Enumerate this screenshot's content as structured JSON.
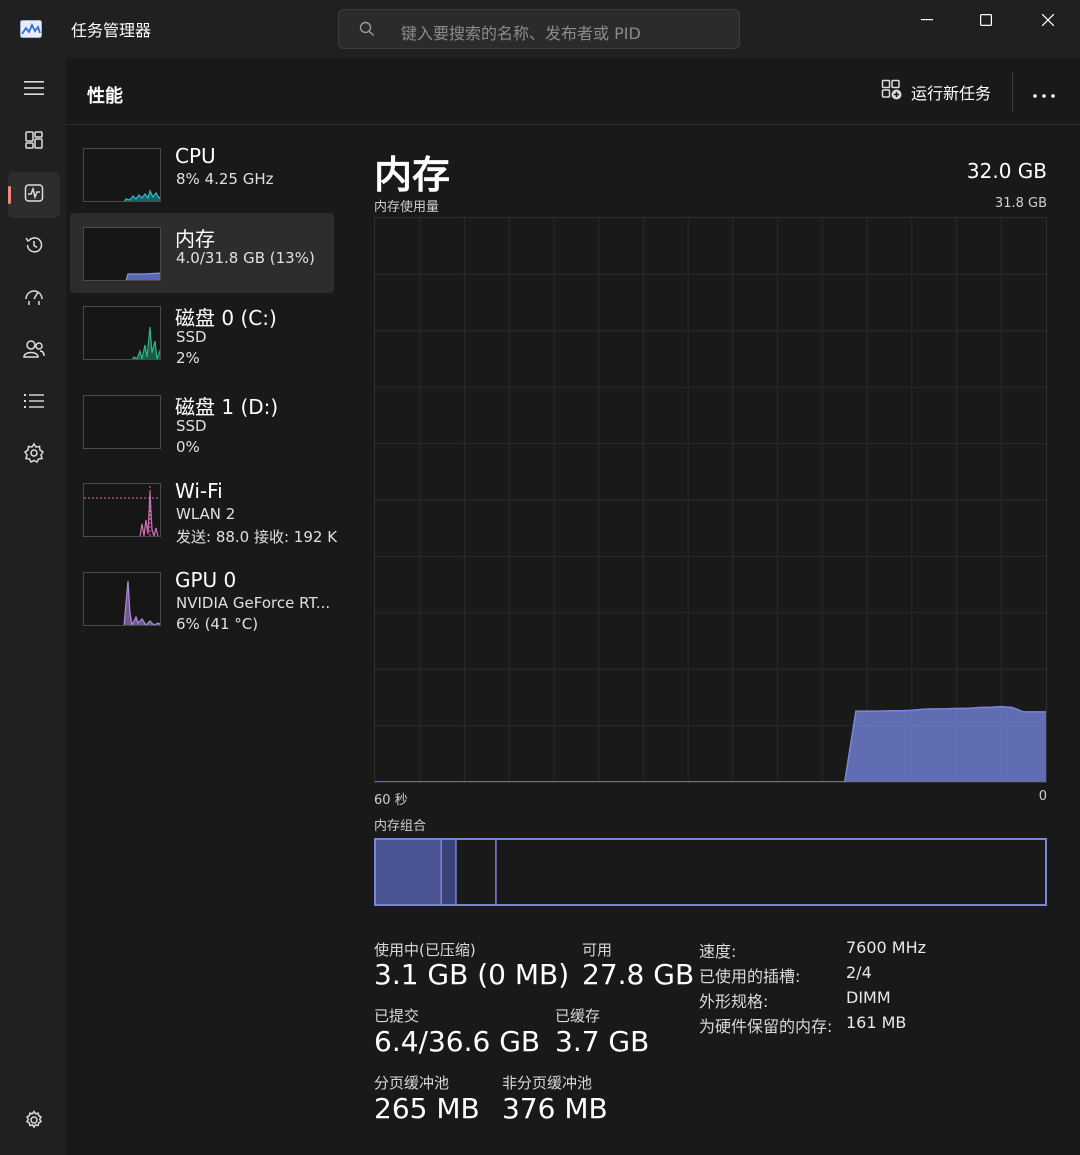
{
  "app": {
    "title": "任务管理器",
    "search_placeholder": "键入要搜索的名称、发布者或 PID"
  },
  "colors": {
    "memory_fill": "#6f7ccf",
    "memory_border": "#7a86d6",
    "cpu_line": "#2bbfc8",
    "disk_line": "#32b48c",
    "wifi_line": "#d070b8",
    "gpu_line": "#b08ad8",
    "active_indicator": "#f08a7a"
  },
  "nav": {
    "items": [
      {
        "icon": "hamburger-menu-icon"
      },
      {
        "icon": "processes-icon"
      },
      {
        "icon": "performance-icon",
        "active": true
      },
      {
        "icon": "app-history-icon"
      },
      {
        "icon": "startup-apps-icon"
      },
      {
        "icon": "users-icon"
      },
      {
        "icon": "details-icon"
      },
      {
        "icon": "services-icon"
      },
      {
        "icon": "settings-icon"
      }
    ]
  },
  "header": {
    "title": "性能",
    "run_task_label": "运行新任务"
  },
  "devices": [
    {
      "title": "CPU",
      "sub1": "8% 4.25 GHz",
      "sub2": "",
      "graph": "cpu"
    },
    {
      "title": "内存",
      "sub1": "4.0/31.8 GB (13%)",
      "sub2": "",
      "graph": "memory",
      "selected": true
    },
    {
      "title": "磁盘 0 (C:)",
      "sub1": "SSD",
      "sub2": "2%",
      "graph": "disk0"
    },
    {
      "title": "磁盘 1 (D:)",
      "sub1": "SSD",
      "sub2": "0%",
      "graph": "disk1"
    },
    {
      "title": "Wi-Fi",
      "sub1": "WLAN 2",
      "sub2": "发送: 88.0 接收: 192 K",
      "graph": "wifi"
    },
    {
      "title": "GPU 0",
      "sub1": "NVIDIA GeForce RT...",
      "sub2": "6% (41 °C)",
      "graph": "gpu"
    }
  ],
  "detail": {
    "title": "内存",
    "total": "32.0 GB",
    "usage_label": "内存使用量",
    "usage_max": "31.8 GB",
    "time_left": "60 秒",
    "time_right": "0",
    "composition_label": "内存组合",
    "usage_history_gb": [
      0,
      0,
      0,
      0,
      0,
      0,
      0,
      0,
      0,
      0,
      0,
      0,
      0,
      0,
      0,
      0,
      0,
      0,
      0,
      0,
      0,
      0,
      0,
      0,
      0,
      0,
      0,
      0,
      0,
      0,
      0,
      0,
      0,
      0,
      0,
      0,
      0,
      0,
      0,
      0,
      0,
      0,
      0,
      4.0,
      4.0,
      4.0,
      4.02,
      4.02,
      4.05,
      4.1,
      4.12,
      4.12,
      4.15,
      4.15,
      4.2,
      4.22,
      4.25,
      4.2,
      3.95,
      3.95,
      3.95
    ],
    "composition": {
      "in_use_gb": 3.1,
      "modified_gb": 0.7,
      "standby_gb": 1.9,
      "total_gb": 31.8
    }
  },
  "stats": {
    "in_use_label": "使用中(已压缩)",
    "in_use_value": "3.1 GB (0 MB)",
    "available_label": "可用",
    "available_value": "27.8 GB",
    "committed_label": "已提交",
    "committed_value": "6.4/36.6 GB",
    "cached_label": "已缓存",
    "cached_value": "3.7 GB",
    "paged_label": "分页缓冲池",
    "paged_value": "265 MB",
    "nonpaged_label": "非分页缓冲池",
    "nonpaged_value": "376 MB"
  },
  "specs": [
    {
      "label": "速度:",
      "value": "7600 MHz"
    },
    {
      "label": "已使用的插槽:",
      "value": "2/4"
    },
    {
      "label": "外形规格:",
      "value": "DIMM"
    },
    {
      "label": "为硬件保留的内存:",
      "value": "161 MB"
    }
  ]
}
